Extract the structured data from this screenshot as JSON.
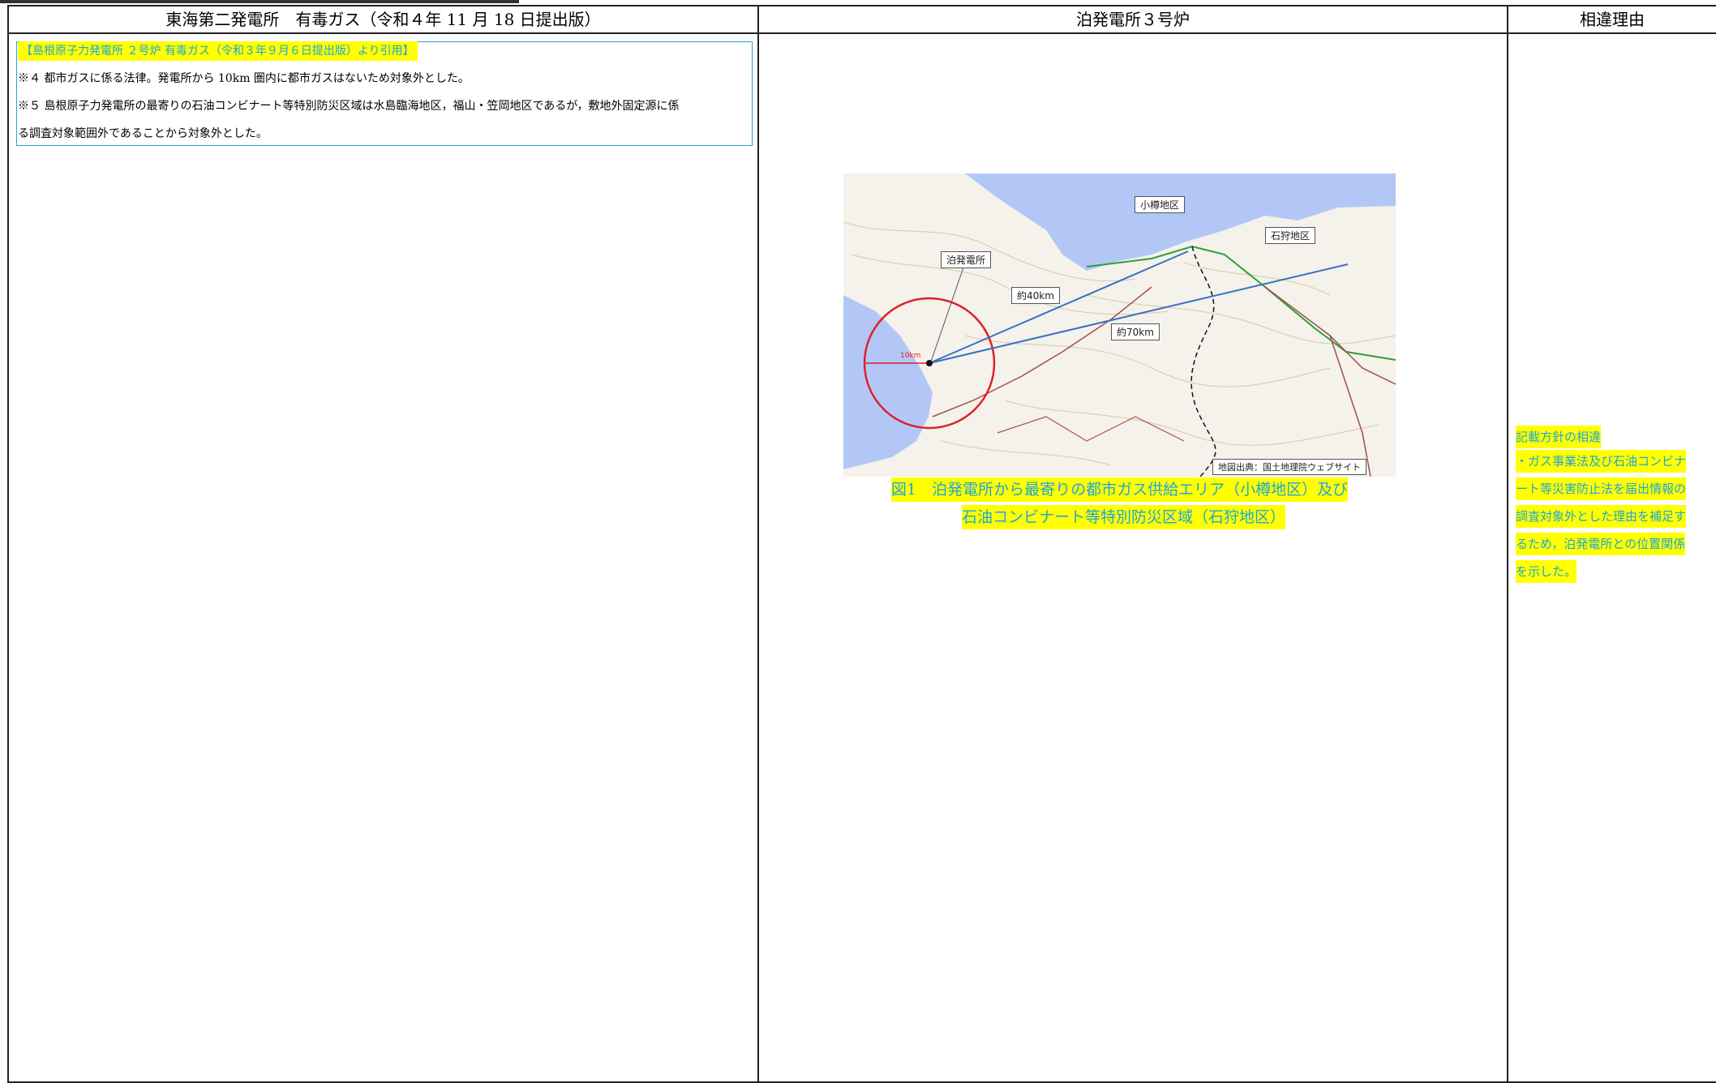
{
  "headers": {
    "col1": "東海第二発電所　有毒ガス（令和４年 11 月 18 日提出版）",
    "col2": "泊発電所３号炉",
    "col3": "相違理由"
  },
  "left": {
    "quote_title": "【島根原子力発電所 ２号炉 有毒ガス（令和３年９月６日提出版）より引用】",
    "note4": "※４ 都市ガスに係る法律。発電所から 10km 圏内に都市ガスはないため対象外とした。",
    "note5_line1": "※５ 島根原子力発電所の最寄りの石油コンビナート等特別防災区域は水島臨海地区，福山・笠岡地区であるが，敷地外固定源に係",
    "note5_line2": "る調査対象範囲外であることから対象外とした。"
  },
  "map": {
    "labels": {
      "otaru": "小樽地区",
      "ishikari": "石狩地区",
      "tomari": "泊発電所",
      "d40": "約40km",
      "d70": "約70km",
      "radius": "10km",
      "source": "地図出典：国土地理院ウェブサイト"
    },
    "colors": {
      "sea": "#b3c7f7",
      "land": "#f4f2ea",
      "circle": "#e0202a",
      "line": "#3a6fc4"
    }
  },
  "caption": {
    "line1": "図1　泊発電所から最寄りの都市ガス供給エリア（小樽地区）及び",
    "line2": "石油コンビナート等特別防災区域（石狩地区）"
  },
  "reason": {
    "line1": "記載方針の相違",
    "line2": "・ガス事業法及び石油コンビナ",
    "line3": "ート等災害防止法を届出情報の",
    "line4": "調査対象外とした理由を補足す",
    "line5": "るため，泊発電所との位置関係",
    "line6": "を示した。"
  }
}
